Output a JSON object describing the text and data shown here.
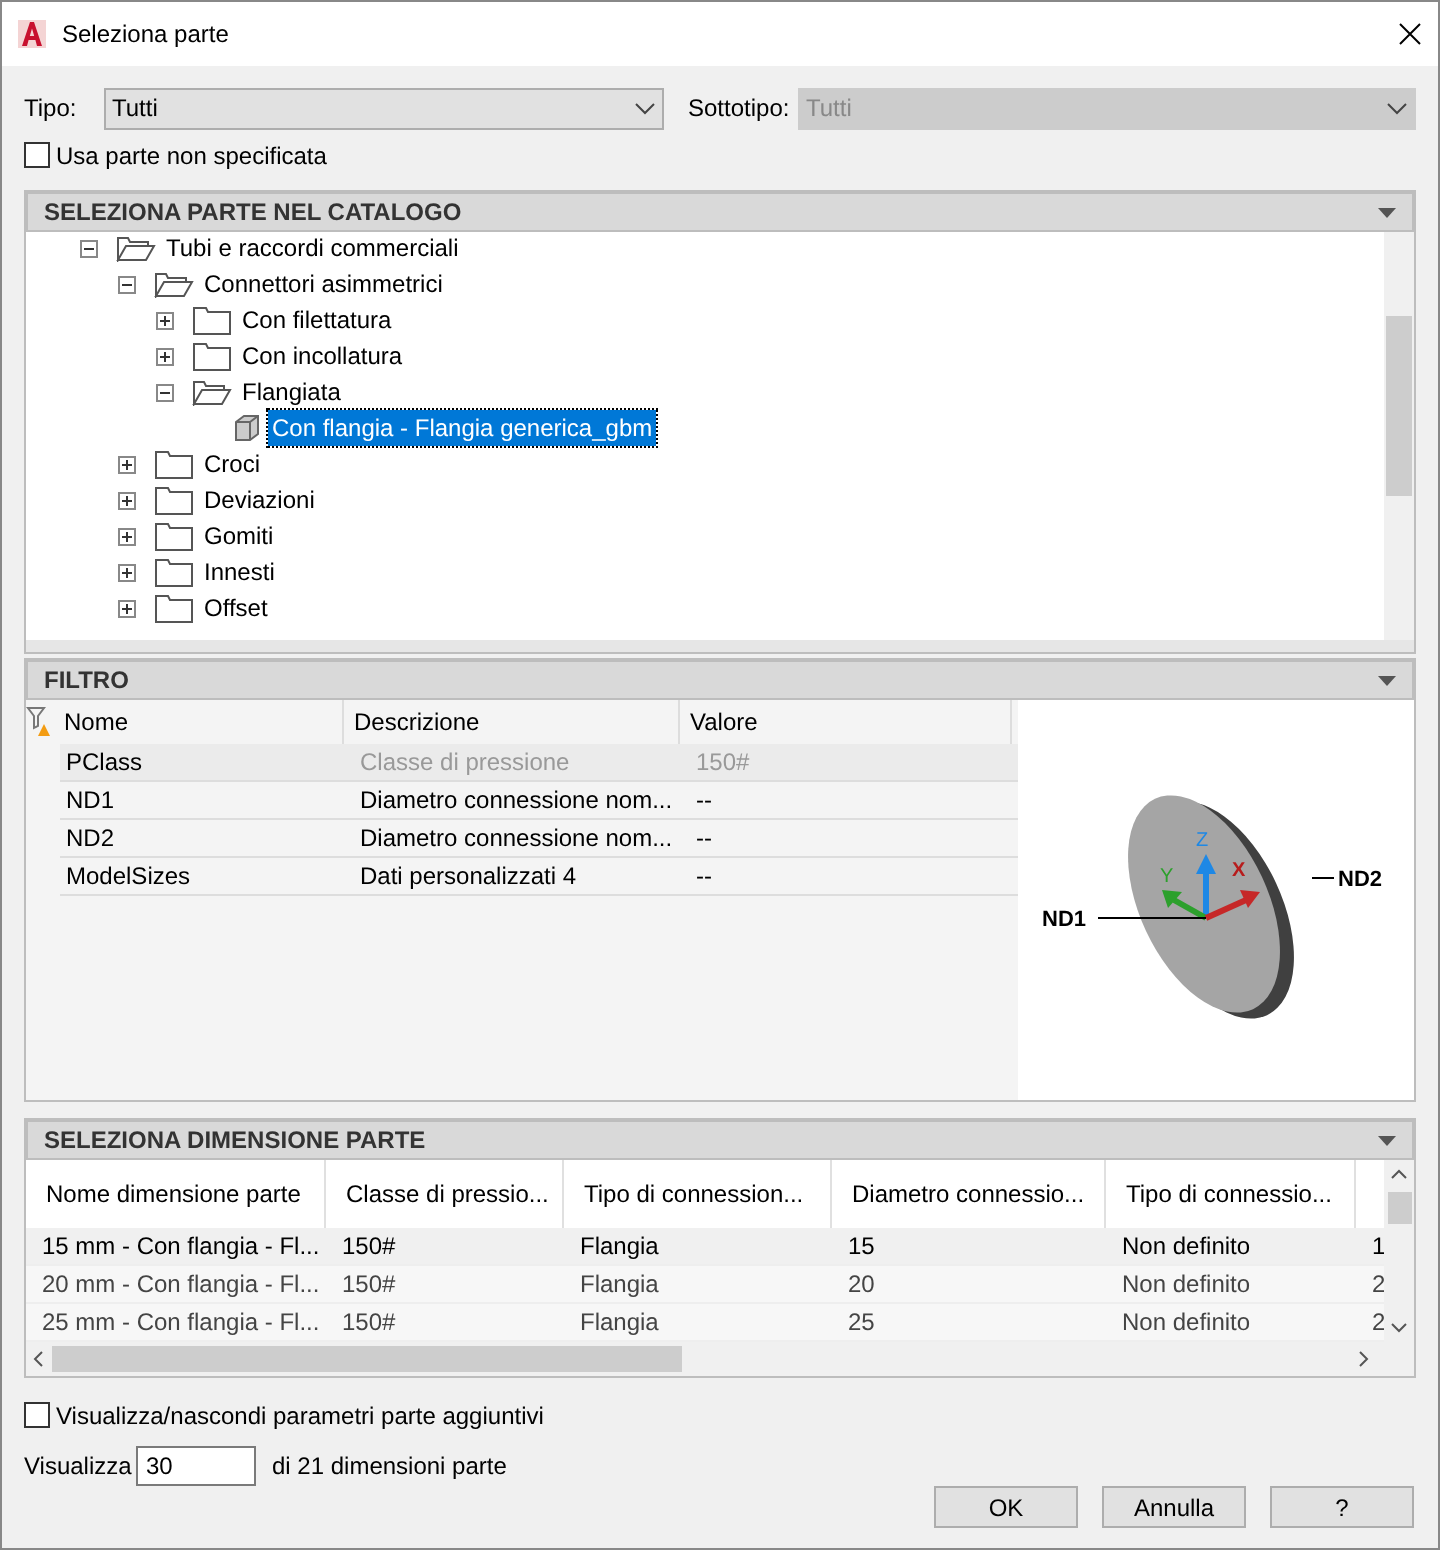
{
  "window": {
    "title": "Seleziona parte"
  },
  "tipo": {
    "label": "Tipo:",
    "value": "Tutti",
    "disabled": false
  },
  "sottotipo": {
    "label": "Sottotipo:",
    "value": "Tutti",
    "disabled": true
  },
  "use_unspecified": {
    "label": "Usa parte non specificata",
    "checked": false
  },
  "catalog": {
    "title": "SELEZIONA PARTE NEL CATALOGO",
    "tree": [
      {
        "label": "Tubi e raccordi commerciali",
        "kind": "folder",
        "expanded": true,
        "selected": false,
        "children": [
          {
            "label": "Connettori asimmetrici",
            "kind": "folder",
            "expanded": true,
            "selected": false,
            "children": [
              {
                "label": "Con filettatura",
                "kind": "folder",
                "expanded": false,
                "selected": false
              },
              {
                "label": "Con incollatura",
                "kind": "folder",
                "expanded": false,
                "selected": false
              },
              {
                "label": "Flangiata",
                "kind": "folder",
                "expanded": true,
                "selected": false,
                "children": [
                  {
                    "label": "Con flangia - Flangia generica_gbm",
                    "kind": "part",
                    "selected": true
                  }
                ]
              }
            ]
          },
          {
            "label": "Croci",
            "kind": "folder",
            "expanded": false,
            "selected": false
          },
          {
            "label": "Deviazioni",
            "kind": "folder",
            "expanded": false,
            "selected": false
          },
          {
            "label": "Gomiti",
            "kind": "folder",
            "expanded": false,
            "selected": false
          },
          {
            "label": "Innesti",
            "kind": "folder",
            "expanded": false,
            "selected": false
          },
          {
            "label": "Offset",
            "kind": "folder",
            "expanded": false,
            "selected": false
          }
        ]
      }
    ]
  },
  "filter": {
    "title": "FILTRO",
    "columns": [
      "Nome",
      "Descrizione",
      "Valore"
    ],
    "rows": [
      {
        "name": "PClass",
        "description": "Classe di pressione",
        "value": "150#",
        "disabled": true
      },
      {
        "name": "ND1",
        "description": "Diametro connessione nom...",
        "value": "--",
        "disabled": false
      },
      {
        "name": "ND2",
        "description": "Diametro connessione nom...",
        "value": "--",
        "disabled": false
      },
      {
        "name": "ModelSizes",
        "description": "Dati personalizzati 4",
        "value": "--",
        "disabled": false
      }
    ],
    "preview": {
      "labels": [
        "ND1",
        "ND2"
      ],
      "axes": [
        "X",
        "Y",
        "Z"
      ]
    }
  },
  "sizes": {
    "title": "SELEZIONA DIMENSIONE PARTE",
    "columns": [
      "Nome dimensione parte",
      "Classe di pressio...",
      "Tipo di connession...",
      "Diametro connessio...",
      "Tipo di connessio..."
    ],
    "rows": [
      {
        "cells": [
          "15 mm - Con flangia - Fl...",
          "150#",
          "Flangia",
          "15",
          "Non definito",
          "1"
        ],
        "selected": true
      },
      {
        "cells": [
          "20 mm - Con flangia - Fl...",
          "150#",
          "Flangia",
          "20",
          "Non definito",
          "2"
        ],
        "selected": false
      },
      {
        "cells": [
          "25 mm - Con flangia - Fl...",
          "150#",
          "Flangia",
          "25",
          "Non definito",
          "2"
        ],
        "selected": false
      }
    ]
  },
  "show_extra": {
    "label": "Visualizza/nascondi parametri parte aggiuntivi",
    "checked": false
  },
  "display": {
    "label": "Visualizza",
    "value": "30",
    "suffix": "di 21 dimensioni parte"
  },
  "buttons": [
    "OK",
    "Annulla",
    "?"
  ]
}
